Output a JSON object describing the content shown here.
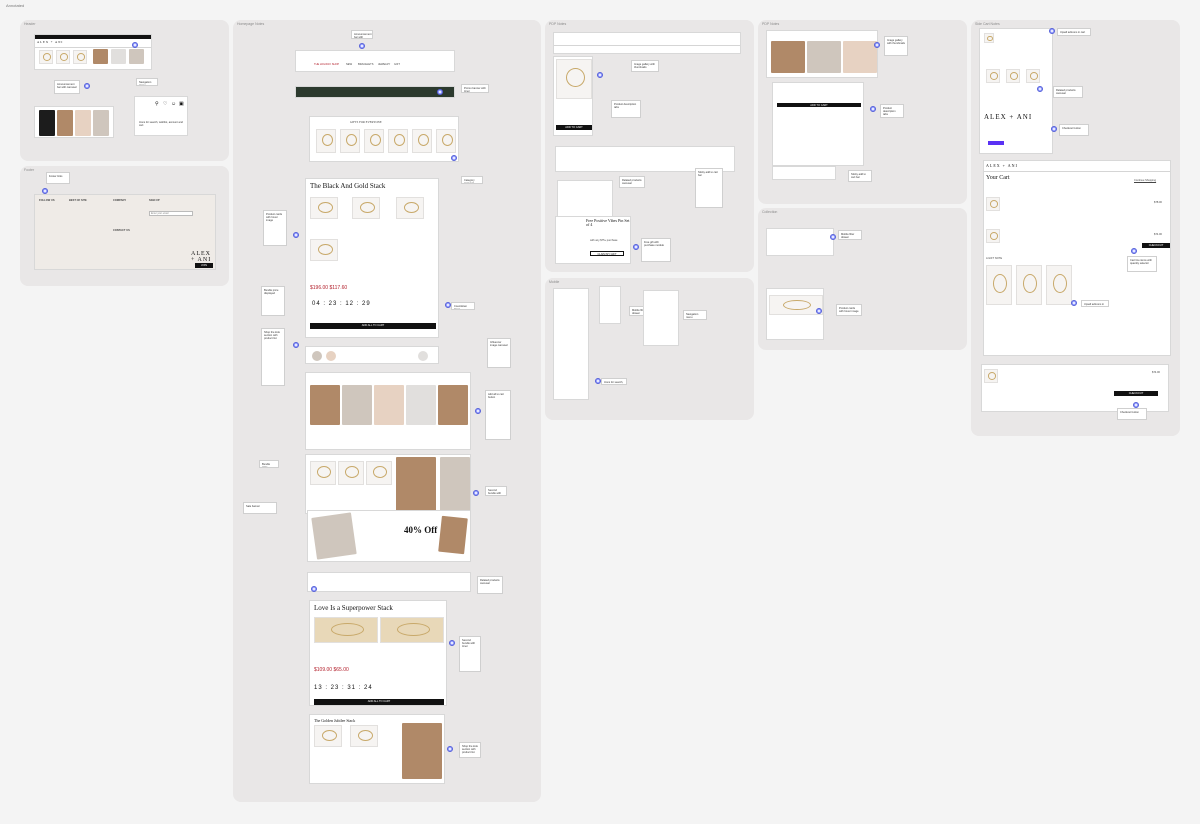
{
  "canvas_label": "Annotated",
  "frames": {
    "header": "Header",
    "homepage": "Homepage Notes",
    "pdp": "PDP Notes",
    "pdp2": "PDP Notes",
    "cart": "Side Cart Notes",
    "footer": "Footer",
    "collection": "Collection",
    "mobile": "Mobile"
  },
  "homepage": {
    "stack_title": "The Black And Gold Stack",
    "timer": "04 : 23 : 12 : 29",
    "add_button": "ADD ALL TO CART",
    "superpower_title": "Love Is a Superpower Stack",
    "superpower_timer": "13 : 23 : 31 : 24",
    "superpower_price": "$109.00 $65.00",
    "old_price": "$196.00 $117.60",
    "fabulous_title": "The Golden Jubilee Stack",
    "sale_badge": "40% Off",
    "nav": [
      "THE HOLIDAY SHOP",
      "NEW",
      "BRACELETS",
      "JEWELRY",
      "GIFT"
    ],
    "gifts_heading": "GIFTS FOR EVERYONE"
  },
  "pdp": {
    "vibes_title": "Free Positive Vibes Pin Set of 4",
    "vibes_sub": "with any $75+ purchase",
    "vibes_button": "CLAIM MY GIFT",
    "add_to_cart": "ADD TO CART"
  },
  "cart": {
    "logo": "ALEX + ANI",
    "title": "Your Cart",
    "checkout": "CHECKOUT",
    "continue": "Continue Shopping",
    "price_1": "$78.00",
    "price_2": "$74.00",
    "gift_wrap": "A GIFT NOTE",
    "item_total": "$74.00"
  },
  "footer": {
    "logo_line1": "ALEX",
    "logo_line2": "+ ANI",
    "follow": "FOLLOW US",
    "sign_up": "SIGN UP",
    "email_placeholder": "Enter your email",
    "join_button": "JOIN",
    "col1": "BEST OF SITE",
    "col2": "COMPANY",
    "col3": "CONTACT US"
  },
  "notes": {
    "n1": "Announcement bar with carousel",
    "n2": "Navigation menu",
    "n3": "Icons for search, wishlist, account and cart",
    "n4": "Product cards with hover image",
    "n5": "Promo banner with timer",
    "n6": "Category carousel",
    "n7": "Shop the look section with product list",
    "n8": "Countdown timer",
    "n9": "Bundle price displayed",
    "n10": "Influencer image carousel",
    "n11": "Add all to cart button",
    "n12": "Sale banner",
    "n13": "Second bundle with timer",
    "n14": "Image gallery with thumbnails",
    "n15": "Product description tabs",
    "n16": "Free gift with purchase module",
    "n17": "Sticky add to cart bar",
    "n18": "Related products carousel",
    "n19": "Cart line items with quantity selector",
    "n20": "Upsell add-ons in cart",
    "n21": "Checkout button",
    "n22": "Newsletter sign-up",
    "n23": "Footer links",
    "n24": "Mobile filter drawer"
  },
  "colors": {
    "accent": "#9aa3ff",
    "sale": "#b3202c",
    "dark": "#111111"
  }
}
